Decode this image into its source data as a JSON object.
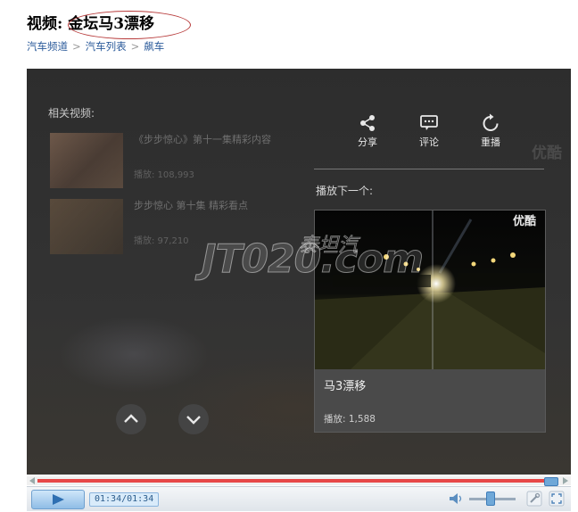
{
  "page": {
    "title_prefix": "视频:",
    "title_subject": "金坛马3漂移",
    "breadcrumb": [
      "汽车频道",
      "汽车列表",
      "飙车"
    ]
  },
  "player": {
    "related_label": "相关视频:",
    "related": [
      {
        "title": "《步步惊心》第十一集精彩内容",
        "plays": "播放: 108,993"
      },
      {
        "title": "步步惊心 第十集 精彩看点",
        "plays": "播放: 97,210"
      }
    ],
    "actions": {
      "share": "分享",
      "comment": "评论",
      "replay": "重播"
    },
    "next_label": "播放下一个:",
    "next_video": {
      "title": "马3漂移",
      "plays": "播放: 1,588",
      "logo": "优酷"
    },
    "youku_logo": "优酷",
    "watermark": "JT020.com",
    "watermark_cn": "泰坦汽",
    "controls": {
      "time": "01:34/01:34",
      "progress": 1.0,
      "volume": 0.45
    }
  },
  "icons": {
    "share": "share-icon",
    "comment": "comment-icon",
    "replay": "replay-icon",
    "up": "chevron-up-icon",
    "down": "chevron-down-icon",
    "play": "play-icon",
    "volume": "volume-icon",
    "settings": "wrench-icon",
    "fullscreen": "fullscreen-icon"
  },
  "colors": {
    "accent": "#e74747",
    "link": "#2a5a9a",
    "player_bg": "#2c2c2c",
    "control_blue": "#6fa8d8"
  }
}
